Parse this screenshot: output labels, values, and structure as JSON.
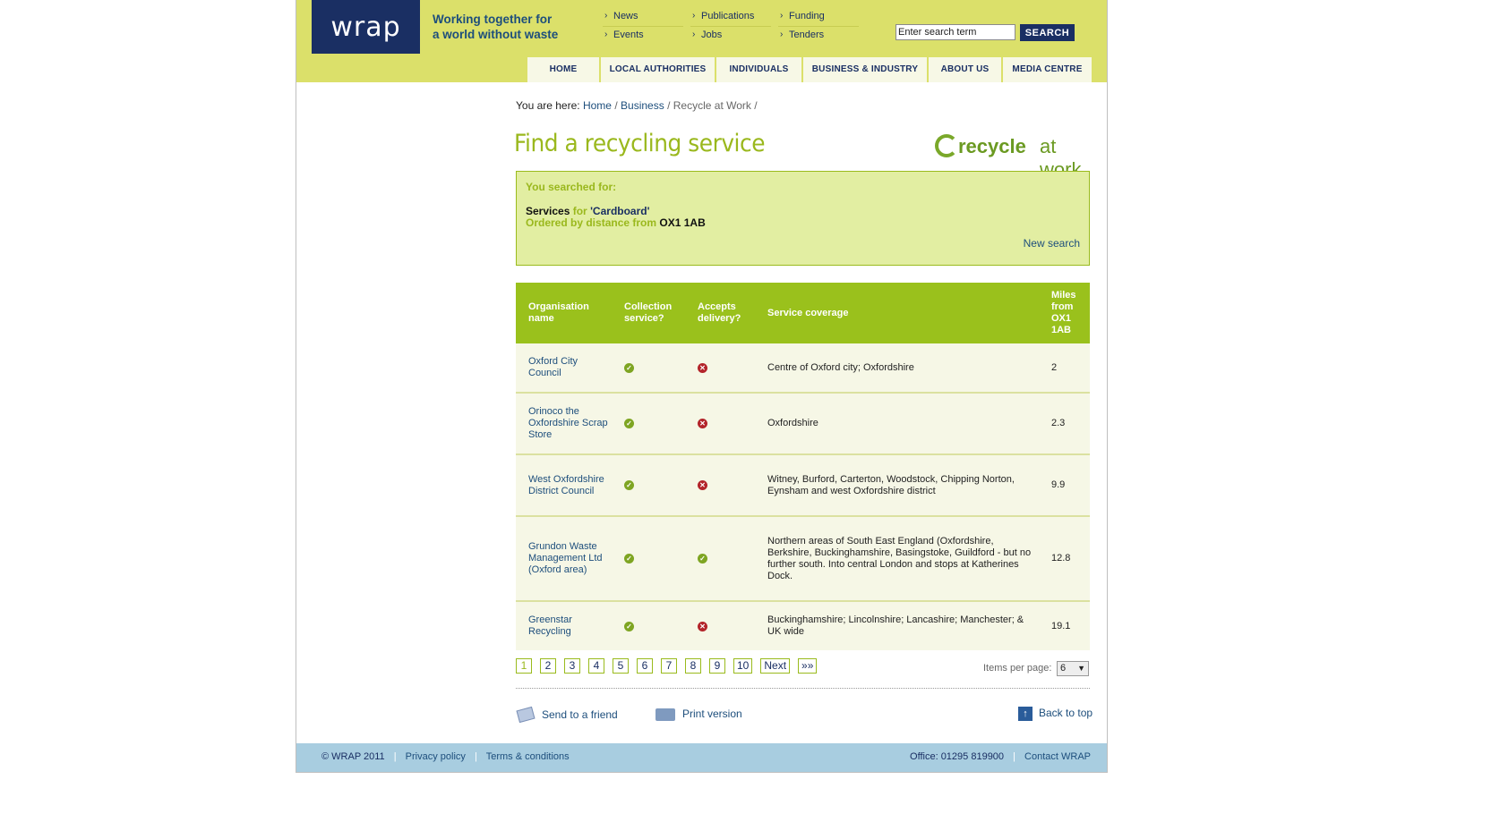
{
  "header": {
    "logo_text": "wrap",
    "tagline_line1": "Working together for",
    "tagline_line2": "a world without waste",
    "topnav": [
      [
        "News",
        "Events"
      ],
      [
        "Publications",
        "Jobs"
      ],
      [
        "Funding",
        "Tenders"
      ]
    ],
    "search_placeholder": "Enter search term",
    "search_value": "Enter search term",
    "search_button": "SEARCH",
    "mainnav": [
      "HOME",
      "LOCAL AUTHORITIES",
      "INDIVIDUALS",
      "BUSINESS & INDUSTRY",
      "ABOUT US",
      "MEDIA CENTRE"
    ]
  },
  "breadcrumb": {
    "prefix": "You are here:",
    "home": "Home",
    "business": "Business",
    "current": "Recycle at Work",
    "sep": "/"
  },
  "page_title": "Find a recycling service",
  "brand_logo": {
    "word1": "recycle",
    "word2": "at work"
  },
  "summary": {
    "heading": "You searched for:",
    "services": "Services",
    "for_word": "for",
    "term": "'Cardboard'",
    "ordered_by": "Ordered by distance from",
    "postcode": "OX1 1AB",
    "new_search": "New search"
  },
  "table": {
    "headers": {
      "org": "Organisation name",
      "collection": "Collection service?",
      "delivery": "Accepts delivery?",
      "coverage": "Service coverage",
      "miles": "Miles from OX1 1AB"
    },
    "rows": [
      {
        "org": "Oxford City Council",
        "collection": "yes",
        "delivery": "no",
        "coverage": "Centre of Oxford city; Oxfordshire",
        "miles": "2"
      },
      {
        "org": "Orinoco the Oxfordshire Scrap Store",
        "collection": "yes",
        "delivery": "no",
        "coverage": "Oxfordshire",
        "miles": "2.3"
      },
      {
        "org": "West Oxfordshire District Council",
        "collection": "yes",
        "delivery": "no",
        "coverage": "Witney, Burford, Carterton, Woodstock, Chipping Norton, Eynsham and west Oxfordshire district",
        "miles": "9.9"
      },
      {
        "org": "Grundon Waste Management Ltd (Oxford area)",
        "collection": "yes",
        "delivery": "yes",
        "coverage": "Northern areas of South East England (Oxfordshire, Berkshire, Buckinghamshire, Basingstoke, Guildford - but no further south. Into central London and stops at Katherines Dock.",
        "miles": "12.8"
      },
      {
        "org": "Greenstar Recycling",
        "collection": "yes",
        "delivery": "no",
        "coverage": "Buckinghamshire; Lincolnshire; Lancashire; Manchester; & UK wide",
        "miles": "19.1"
      }
    ]
  },
  "pagination": {
    "pages": [
      "1",
      "2",
      "3",
      "4",
      "5",
      "6",
      "7",
      "8",
      "9",
      "10"
    ],
    "current": "1",
    "next": "Next",
    "last": "»»",
    "items_per_page_label": "Items per page:",
    "items_per_page_value": "6"
  },
  "utility": {
    "send": "Send to a friend",
    "print": "Print version",
    "back": "Back to top"
  },
  "footer": {
    "copyright": "© WRAP 2011",
    "privacy": "Privacy policy",
    "terms": "Terms & conditions",
    "office": "Office: 01295 819900",
    "contact": "Contact WRAP",
    "sep": "|"
  },
  "colors": {
    "header_bg": "#dbe06a",
    "navy": "#1a2f63",
    "green": "#9ac11c",
    "footer_bg": "#a8cde0"
  }
}
